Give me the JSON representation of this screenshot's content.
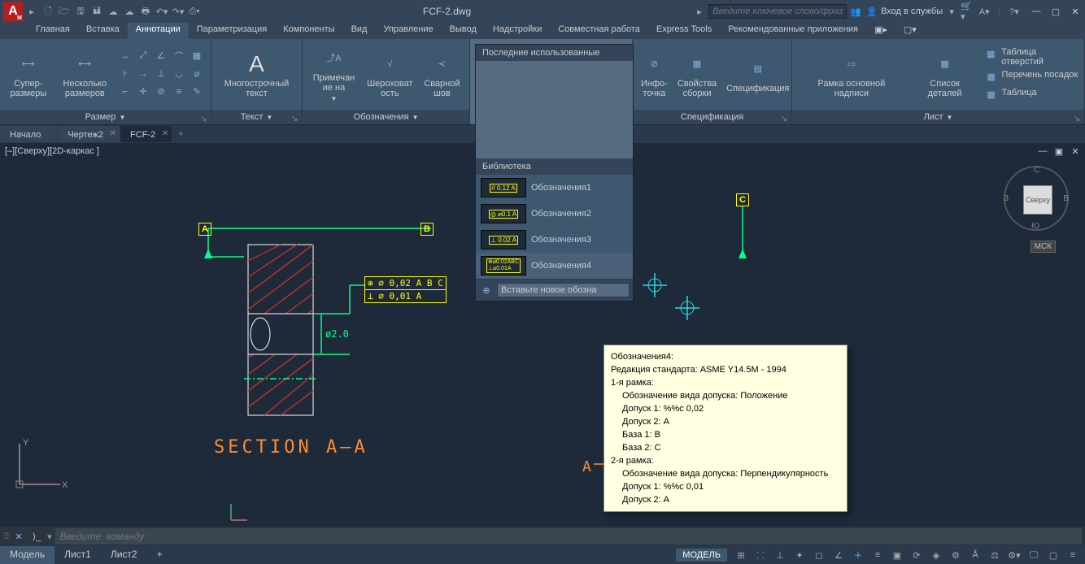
{
  "title": "FCF-2.dwg",
  "search_placeholder": "Введите ключевое слово/фразу",
  "login": "Вход в службы",
  "ribbon_tabs": [
    "Главная",
    "Вставка",
    "Аннотации",
    "Параметризация",
    "Компоненты",
    "Вид",
    "Управление",
    "Вывод",
    "Надстройки",
    "Совместная работа",
    "Express Tools",
    "Рекомендованные приложения"
  ],
  "active_ribbon": 2,
  "panels": {
    "dim": {
      "title": "Размер",
      "b1": "Супер-размеры",
      "b2": "Несколько размеров"
    },
    "text": {
      "title": "Текст",
      "b1": "Многострочный текст"
    },
    "sym": {
      "title": "Обозначения",
      "b1": "Примечан ие на",
      "b2": "Шероховат ость",
      "b3": "Сварной шов"
    },
    "spec": {
      "title": "Спецификация",
      "b1": "Инфо-точка",
      "b2": "Свойства сборки",
      "b3": "Спецификация"
    },
    "sheet": {
      "title": "Лист",
      "b1": "Рамка основной надписи",
      "b2": "Список деталей",
      "i1": "Таблица отверстий",
      "i2": "Перечень посадок",
      "i3": "Таблица"
    }
  },
  "doc_tabs": [
    "Начало",
    "Чертеж2",
    "FCF-2"
  ],
  "active_doc": 2,
  "canvas_label": "[–][Сверху][2D-каркас ]",
  "viewcube": {
    "face": "Сверху",
    "n": "С",
    "s": "Ю",
    "e": "В",
    "w": "З"
  },
  "wcs": "МСК",
  "drawing": {
    "datumA": "A",
    "datumB": "B",
    "datumC": "C",
    "datumA2": "A",
    "dim": "ø2.0",
    "fcf_r1": "⊕ ⌀ 0,02 A B C",
    "fcf_r2": "⊥ ⌀ 0,01 A",
    "section": "SECTION  A—A"
  },
  "dropdown": {
    "recent": "Последние использованные",
    "library": "Библиотека",
    "items": [
      "Обозначения1",
      "Обозначения2",
      "Обозначения3",
      "Обозначения4"
    ],
    "input": "Вставьте новое обозна"
  },
  "tooltip": {
    "t": "Обозначения4:",
    "l1": "Редакция стандарта: ASME Y14.5M - 1994",
    "l2": "1-я рамка:",
    "l3": "Обозначение вида допуска: Положение",
    "l4": "Допуск 1: %%c 0,02",
    "l5": "Допуск 2: A",
    "l6": "База 1: B",
    "l7": "База 2: C",
    "l8": "2-я рамка:",
    "l9": "Обозначение вида допуска: Перпендикулярность",
    "l10": "Допуск 1: %%c 0,01",
    "l11": "Допуск 2: A"
  },
  "cmd_placeholder": "Введите  команду",
  "layout_tabs": [
    "Модель",
    "Лист1",
    "Лист2"
  ],
  "sb_model": "МОДЕЛЬ"
}
